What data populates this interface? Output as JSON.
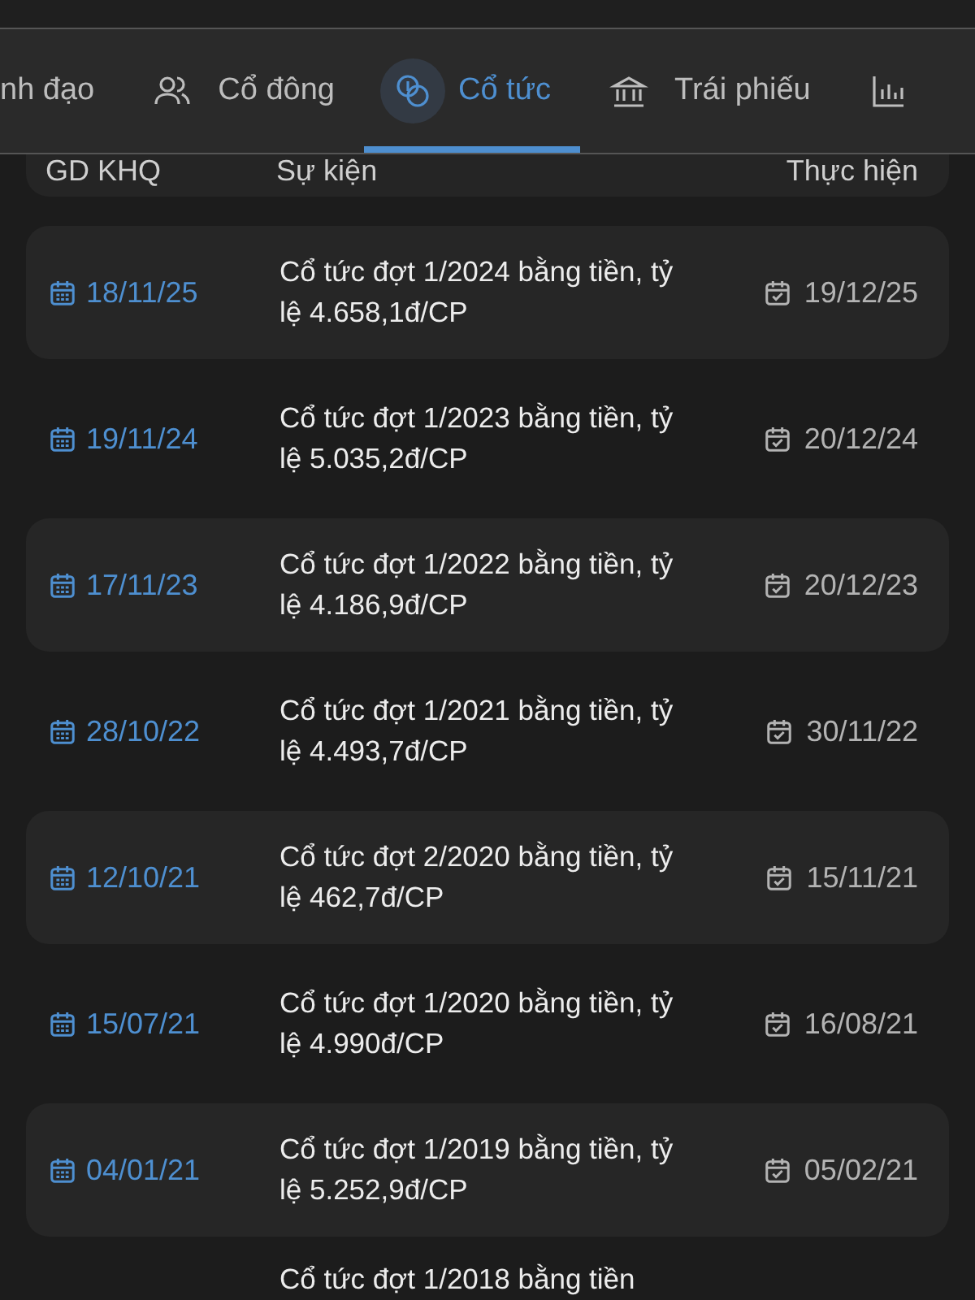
{
  "tabs": [
    {
      "label": "nh đạo",
      "selected": false
    },
    {
      "label": "Cổ đông",
      "selected": false
    },
    {
      "label": "Cổ tức",
      "selected": true
    },
    {
      "label": "Trái phiếu",
      "selected": false
    },
    {
      "selected": false
    }
  ],
  "table": {
    "columns": [
      "GD KHQ",
      "Sự kiện",
      "Thực hiện"
    ],
    "rows": [
      {
        "ex_date": "18/11/25",
        "event": "Cổ tức đợt 1/2024 bằng tiền, tỷ lệ 4.658,1đ/CP",
        "pay_date": "19/12/25"
      },
      {
        "ex_date": "19/11/24",
        "event": "Cổ tức đợt 1/2023 bằng tiền, tỷ lệ 5.035,2đ/CP",
        "pay_date": "20/12/24"
      },
      {
        "ex_date": "17/11/23",
        "event": "Cổ tức đợt 1/2022 bằng tiền, tỷ lệ 4.186,9đ/CP",
        "pay_date": "20/12/23"
      },
      {
        "ex_date": "28/10/22",
        "event": "Cổ tức đợt 1/2021 bằng tiền, tỷ lệ 4.493,7đ/CP",
        "pay_date": "30/11/22"
      },
      {
        "ex_date": "12/10/21",
        "event": "Cổ tức đợt 2/2020 bằng tiền, tỷ lệ 462,7đ/CP",
        "pay_date": "15/11/21"
      },
      {
        "ex_date": "15/07/21",
        "event": "Cổ tức đợt 1/2020 bằng tiền, tỷ lệ 4.990đ/CP",
        "pay_date": "16/08/21"
      },
      {
        "ex_date": "04/01/21",
        "event": "Cổ tức đợt 1/2019 bằng tiền, tỷ lệ 5.252,9đ/CP",
        "pay_date": "05/02/21"
      },
      {
        "event": "Cổ tức đợt 1/2018 bằng tiền"
      }
    ]
  }
}
